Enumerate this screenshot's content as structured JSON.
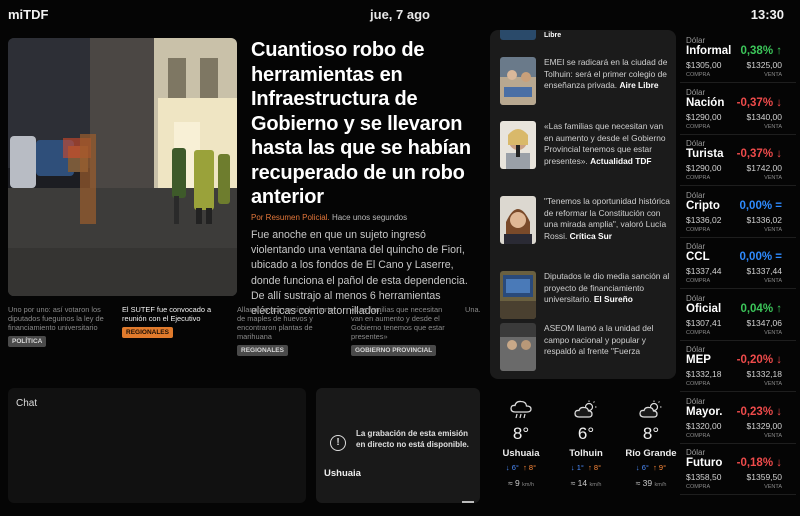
{
  "header": {
    "app_title": "miTDF",
    "date": "jue, 7 ago",
    "time": "13:30"
  },
  "hero": {
    "title": "Cuantioso robo de herramientas en Infraestructura de Gobierno y se llevaron hasta las que se habían recuperado de un robo anterior",
    "source_label": "Por Resumen Policial.",
    "time_ago": "Hace unos segundos",
    "body": "Fue anoche en que un sujeto ingresó violentando una ventana del quincho de Fiori, ubicado a los fondos de El Cano y Laserre, donde funciona el pañol de esta dependencia. De allí sustrajo al menos 6 herramientas eléctricas como atornillador."
  },
  "strip": [
    {
      "text": "Uno por uno: así votaron los diputados fueguinos la ley de financiamiento universitario",
      "tag": "Política",
      "active": false
    },
    {
      "text": "El SUTEF fue convocado a reunión con el Ejecutivo",
      "tag": "Regionales",
      "active": true
    },
    {
      "text": "Allanaron por un simple hurto de maples de huevos y encontraron plantas de marihuana",
      "tag": "Regionales",
      "active": false
    },
    {
      "text": "«Las familias que necesitan van en aumento y desde el Gobierno tenemos que estar presentes»",
      "tag": "Gobierno Provincial",
      "active": false
    },
    {
      "text": "Una...",
      "tag": "",
      "active": false
    }
  ],
  "news": {
    "top_source": "Libre",
    "items": [
      {
        "text": "EMEI se radicará en la ciudad de Tolhuin: será el primer colegio de enseñanza privada.",
        "source": "Aire Libre"
      },
      {
        "text": "«Las familias que necesitan van en aumento y desde el Gobierno Provincial tenemos que estar presentes».",
        "source": "Actualidad TDF"
      },
      {
        "text": "\"Tenemos la oportunidad histórica de reformar la Constitución con una mirada amplia\", valoró Lucía Rossi.",
        "source": "Crítica Sur"
      },
      {
        "text": "Diputados le dio media sanción al proyecto de financiamiento universitario.",
        "source": "El Sureño"
      },
      {
        "text": "ASEOM llamó a la unidad del campo nacional y popular y respaldó al frente \"Fuerza",
        "source": ""
      }
    ]
  },
  "fx": {
    "kind_label": "Dólar",
    "buy_label": "COMPRA",
    "sell_label": "VENTA",
    "colors": {
      "up": "#3cc65a",
      "down": "#ef4b4b",
      "flat": "#2f8bff"
    },
    "rows": [
      {
        "name": "Informal",
        "pct": "0,38%",
        "trend": "up",
        "buy": "$1305,00",
        "sell": "$1325,00"
      },
      {
        "name": "Nación",
        "pct": "-0,37%",
        "trend": "down",
        "buy": "$1290,00",
        "sell": "$1340,00"
      },
      {
        "name": "Turista",
        "pct": "-0,37%",
        "trend": "down",
        "buy": "$1290,00",
        "sell": "$1742,00"
      },
      {
        "name": "Cripto",
        "pct": "0,00%",
        "trend": "flat",
        "buy": "$1336,02",
        "sell": "$1336,02"
      },
      {
        "name": "CCL",
        "pct": "0,00%",
        "trend": "flat",
        "buy": "$1337,44",
        "sell": "$1337,44"
      },
      {
        "name": "Oficial",
        "pct": "0,04%",
        "trend": "up",
        "buy": "$1307,41",
        "sell": "$1347,06"
      },
      {
        "name": "MEP",
        "pct": "-0,20%",
        "trend": "down",
        "buy": "$1332,18",
        "sell": "$1332,18"
      },
      {
        "name": "Mayor.",
        "pct": "-0,23%",
        "trend": "down",
        "buy": "$1320,00",
        "sell": "$1329,00"
      },
      {
        "name": "Futuro",
        "pct": "-0,18%",
        "trend": "down",
        "buy": "$1358,50",
        "sell": "$1359,50"
      }
    ]
  },
  "chat": {
    "title": "Chat"
  },
  "live": {
    "message": "La grabación de esta emisión en directo no está disponible.",
    "city": "Ushuaia"
  },
  "weather": {
    "wind_unit": "km/h",
    "cities": [
      {
        "name": "Ushuaia",
        "temp": "8°",
        "low": "6°",
        "high": "8°",
        "wind": "9",
        "icon": "rain-cloud-icon"
      },
      {
        "name": "Tolhuin",
        "temp": "6°",
        "low": "1°",
        "high": "8°",
        "wind": "14",
        "icon": "partly-cloudy-icon"
      },
      {
        "name": "Río Grande",
        "temp": "8°",
        "low": "6°",
        "high": "9°",
        "wind": "39",
        "icon": "partly-cloudy-icon"
      }
    ]
  }
}
